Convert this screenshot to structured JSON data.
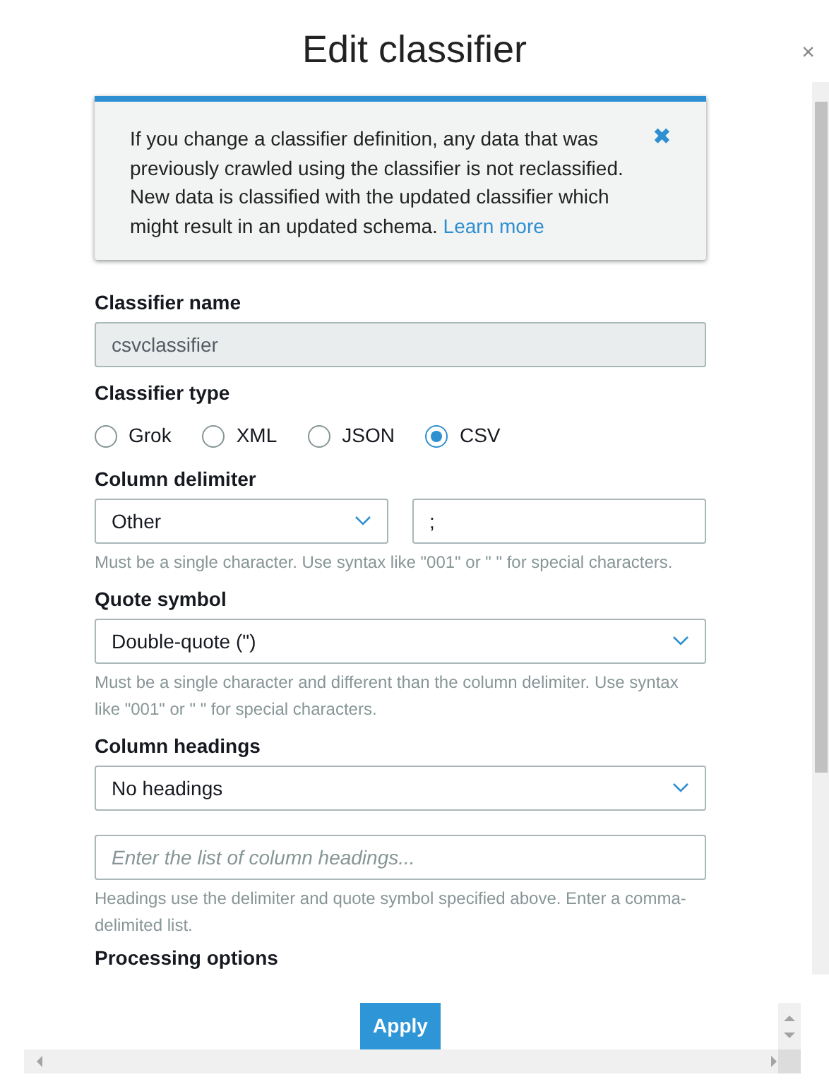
{
  "dialog": {
    "title": "Edit classifier",
    "close": "×"
  },
  "notice": {
    "text": "If you change a classifier definition, any data that was previously crawled using the classifier is not reclassified. New data is classified with the updated classifier which might result in an updated schema.",
    "link": "Learn more",
    "dismiss": "✖"
  },
  "name_field": {
    "label": "Classifier name",
    "value": "csvclassifier",
    "disabled": true
  },
  "type_field": {
    "label": "Classifier type",
    "options": [
      {
        "label": "Grok",
        "selected": false
      },
      {
        "label": "XML",
        "selected": false
      },
      {
        "label": "JSON",
        "selected": false
      },
      {
        "label": "CSV",
        "selected": true
      }
    ]
  },
  "delimiter": {
    "label": "Column delimiter",
    "select": "Other",
    "value": ";",
    "hint": "Must be a single character. Use syntax like \"001\" or \" \" for special characters."
  },
  "quote": {
    "label": "Quote symbol",
    "select": "Double-quote (\")",
    "hint": "Must be a single character and different than the column delimiter. Use syntax like \"001\" or \" \" for special characters."
  },
  "headings": {
    "label": "Column headings",
    "select": "No headings",
    "placeholder": "Enter the list of column headings...",
    "hint": "Headings use the delimiter and quote symbol specified above. Enter a comma-delimited list."
  },
  "next_section": {
    "label": "Processing options"
  },
  "apply_button": "Apply"
}
